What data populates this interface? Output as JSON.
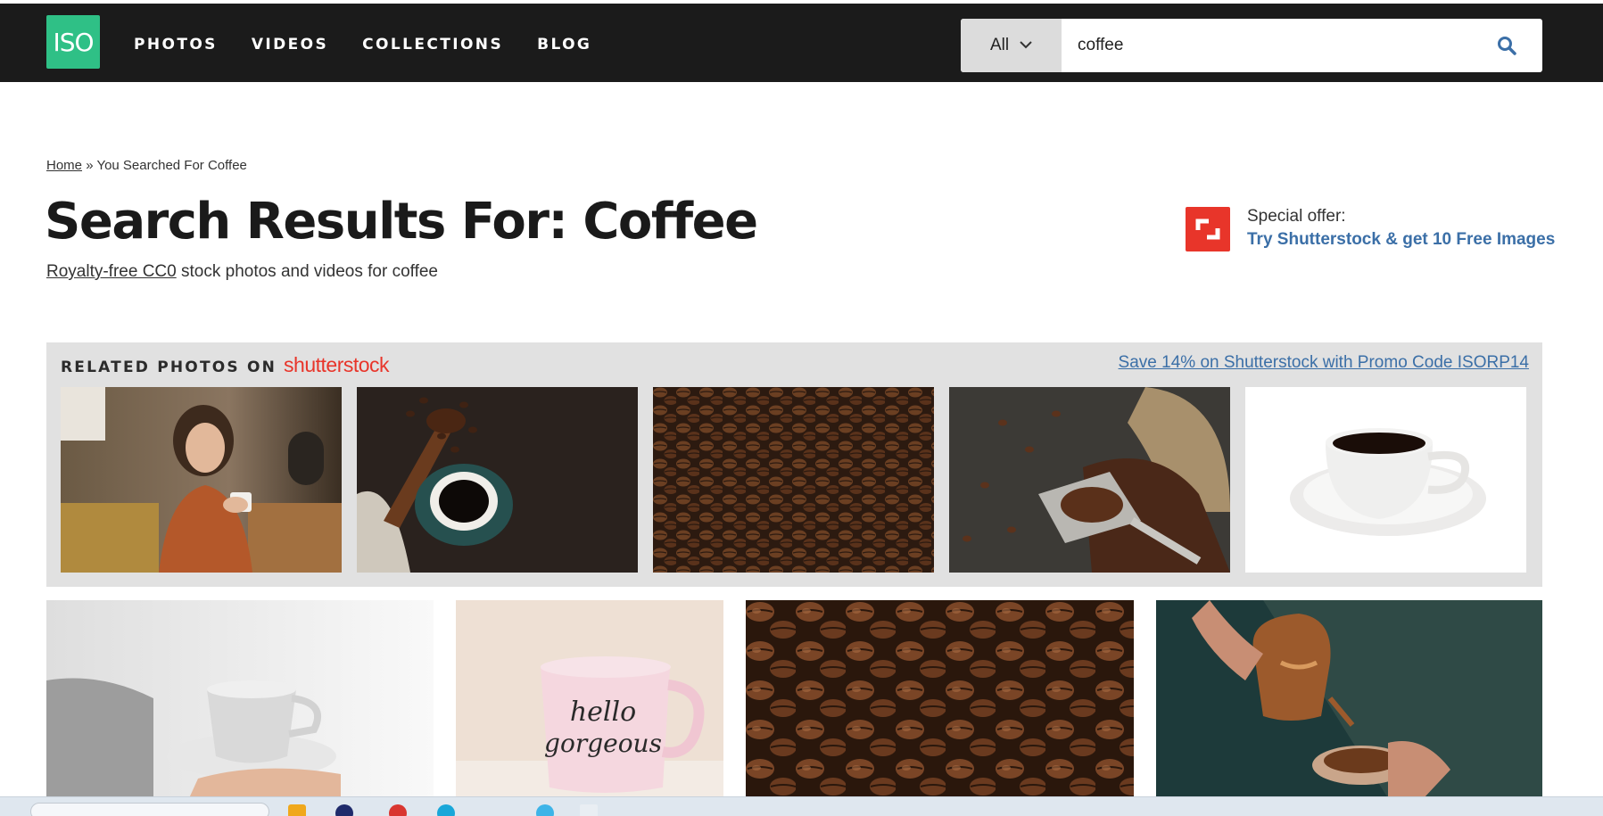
{
  "header": {
    "logo": "ISO",
    "nav": [
      "PHOTOS",
      "VIDEOS",
      "COLLECTIONS",
      "BLOG"
    ],
    "search_type": "All",
    "search_value": "coffee"
  },
  "breadcrumb": {
    "home": "Home",
    "separator": "»",
    "current": "You Searched For Coffee"
  },
  "page": {
    "title": "Search Results For: Coffee",
    "subtitle_link": "Royalty-free CC0",
    "subtitle_rest": " stock photos and videos for coffee"
  },
  "offer": {
    "label": "Special offer:",
    "link": "Try Shutterstock & get 10 Free Images"
  },
  "related": {
    "label": "RELATED PHOTOS ON",
    "brand": "shutterstock",
    "promo": "Save 14% on Shutterstock with Promo Code ISORP14",
    "photos": [
      {
        "subject": "woman-with-coffee-cup"
      },
      {
        "subject": "coffee-cup-with-beans-scoop"
      },
      {
        "subject": "roasted-coffee-beans"
      },
      {
        "subject": "coffee-beans-in-sack-with-scoop"
      },
      {
        "subject": "white-coffee-cup-on-saucer"
      }
    ]
  },
  "results": [
    {
      "subject": "espresso-cup-held-in-hand"
    },
    {
      "subject": "pink-mug-hello-gorgeous"
    },
    {
      "subject": "coffee-beans-closeup"
    },
    {
      "subject": "pour-over-coffee-copper-kettle"
    }
  ],
  "colors": {
    "header_bg": "#1b1b1b",
    "logo_green": "#2fc086",
    "link_blue": "#3b6fa7",
    "shutterstock_red": "#e8352a",
    "related_bg": "#e1e1e1"
  }
}
